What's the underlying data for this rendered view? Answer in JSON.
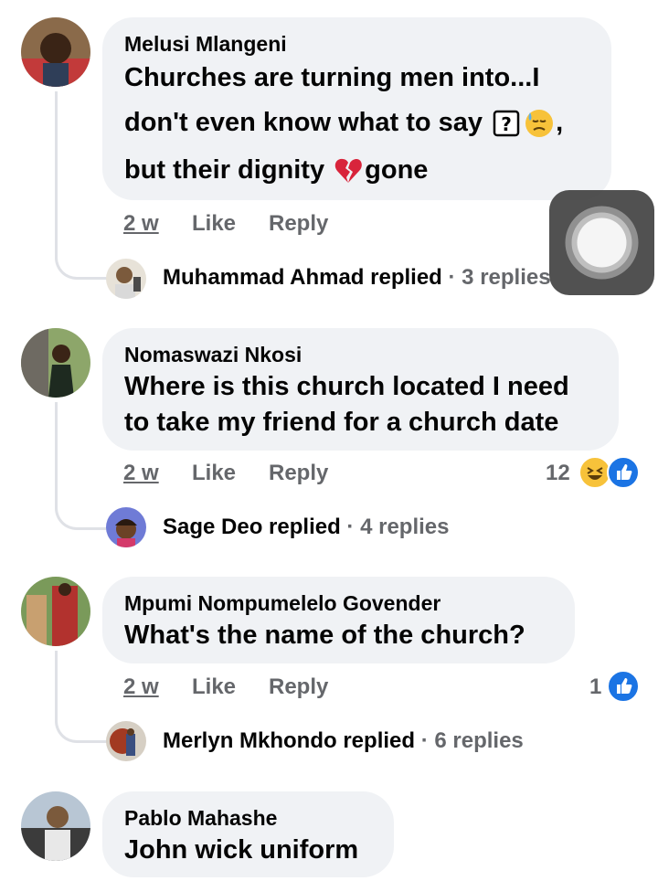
{
  "comments": [
    {
      "author": "Melusi Mlangeni",
      "lines": [
        "Churches are turning men into...I",
        "don't even know what to say",
        ",",
        "but their dignity",
        "gone"
      ],
      "time": "2 w",
      "like": "Like",
      "reply": "Reply",
      "reply_author": "Muhammad Ahmad",
      "reply_verb": "replied",
      "reply_count": "· 3 replies"
    },
    {
      "author": "Nomaswazi Nkosi",
      "lines": [
        "Where is this church located I need",
        "to take my friend for a church date"
      ],
      "time": "2 w",
      "like": "Like",
      "reply": "Reply",
      "reactions": "12",
      "reply_author": "Sage Deo",
      "reply_verb": "replied",
      "reply_count": "· 4 replies"
    },
    {
      "author": "Mpumi Nompumelelo Govender",
      "lines": [
        "What's the name of the church?"
      ],
      "time": "2 w",
      "like": "Like",
      "reply": "Reply",
      "reactions": "1",
      "reply_author": "Merlyn Mkhondo",
      "reply_verb": "replied",
      "reply_count": "· 6 replies"
    },
    {
      "author": "Pablo Mahashe",
      "lines": [
        "John wick uniform"
      ]
    }
  ],
  "icons": {
    "unknown_glyph": "?",
    "colors": {
      "like": "#1b74e4",
      "haha": "#f7c23a",
      "broken_heart": "#d8243b",
      "bubble": "#f0f2f5",
      "muted": "#65676b"
    }
  }
}
